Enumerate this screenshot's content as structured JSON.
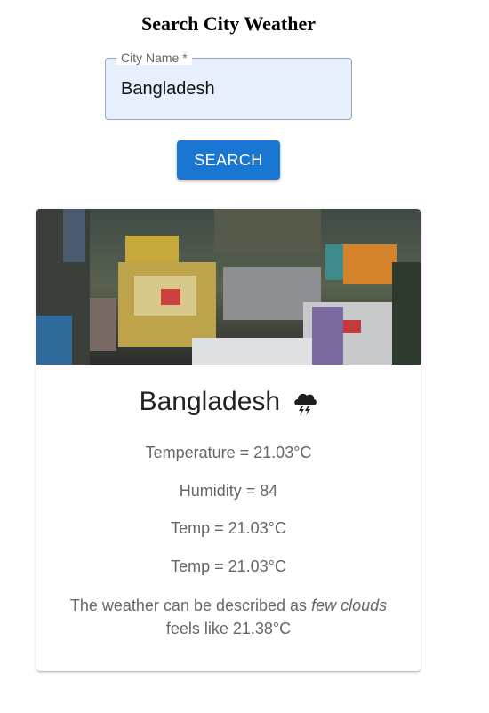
{
  "page": {
    "title": "Search City Weather"
  },
  "search": {
    "label": "City Name *",
    "value": "Bangladesh",
    "button_label": "SEARCH"
  },
  "card": {
    "city": "Bangladesh",
    "icon": "thunderstorm-cloud-icon",
    "temperature": "Temperature = 21.03°C",
    "humidity": "Humidity = 84",
    "temp_1": "Temp = 21.03°C",
    "temp_2": "Temp = 21.03°C",
    "description_prefix": "The weather can be described as",
    "description_value": "few clouds",
    "feels_like": "feels like 21.38°C"
  },
  "colors": {
    "button": "#1976d2",
    "input_background": "#e8f0fe",
    "text_secondary": "#666666"
  }
}
